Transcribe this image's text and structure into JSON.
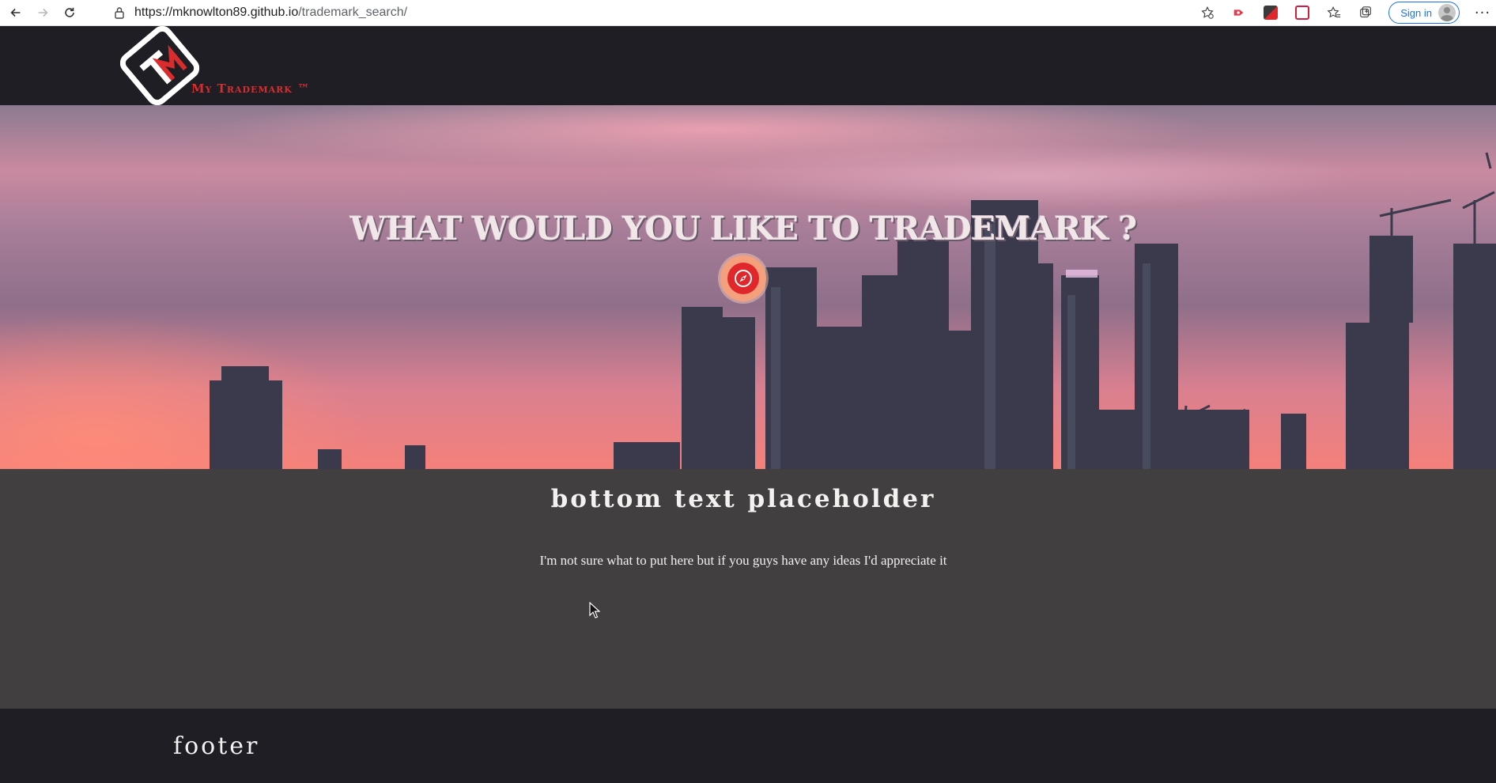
{
  "browser": {
    "url_host": "https://mknowlton89.github.io",
    "url_path": "/trademark_search/",
    "signin_label": "Sign in",
    "icons": [
      "back-icon",
      "forward-icon",
      "refresh-icon",
      "lock-icon",
      "add-favorite-icon",
      "extension-icon",
      "favorites-icon",
      "collections-icon",
      "profile-icon",
      "more-icon"
    ]
  },
  "header": {
    "logo_text": "My Trademark ™",
    "logo_colors": {
      "accent": "#d92c2c",
      "outline": "#ffffff"
    }
  },
  "hero": {
    "title": "WHAT WOULD YOU LIKE TO TRADEMARK ?",
    "search_icon": "compass-icon"
  },
  "content": {
    "heading": "bottom text placeholder",
    "body": "I'm not sure what to put here but if you guys have any ideas I'd appreciate it"
  },
  "footer": {
    "text": "footer"
  },
  "colors": {
    "header_bg": "#1f1e24",
    "content_bg": "#423f40",
    "search_button": "#e0282c",
    "search_ring": "#f5a07c"
  }
}
